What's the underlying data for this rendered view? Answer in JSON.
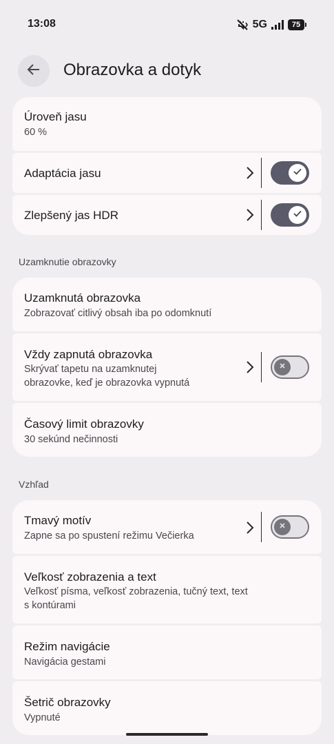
{
  "status_bar": {
    "time": "13:08",
    "network": "5G",
    "battery": "75"
  },
  "header": {
    "title": "Obrazovka a dotyk"
  },
  "brightness_group": {
    "brightness_level": {
      "title": "Úroveň jasu",
      "subtitle": "60 %"
    },
    "adaptive_brightness": {
      "title": "Adaptácia jasu",
      "toggle": "on"
    },
    "hdr_brightness": {
      "title": "Zlepšený jas HDR",
      "toggle": "on"
    }
  },
  "lock_section": {
    "label": "Uzamknutie obrazovky",
    "lock_screen": {
      "title": "Uzamknutá obrazovka",
      "subtitle": "Zobrazovať citlivý obsah iba po odomknutí"
    },
    "always_on": {
      "title": "Vždy zapnutá obrazovka",
      "subtitle_line1": "Skrývať tapetu na uzamknutej",
      "subtitle_line2": "obrazovke, keď je obrazovka vypnutá",
      "toggle": "off"
    },
    "timeout": {
      "title": "Časový limit obrazovky",
      "subtitle": "30 sekúnd nečinnosti"
    }
  },
  "appearance_section": {
    "label": "Vzhľad",
    "dark_theme": {
      "title": "Tmavý motív",
      "subtitle": "Zapne sa po spustení režimu Večierka",
      "toggle": "off"
    },
    "display_size": {
      "title": "Veľkosť zobrazenia a text",
      "subtitle_line1": "Veľkosť písma, veľkosť zobrazenia, tučný text, text",
      "subtitle_line2": "s kontúrami"
    },
    "navigation_mode": {
      "title": "Režim navigácie",
      "subtitle": "Navigácia gestami"
    },
    "screen_saver": {
      "title": "Šetrič obrazovky",
      "subtitle": "Vypnuté"
    }
  },
  "icons": {
    "back": "arrow-left-icon",
    "chevron": "chevron-right-icon",
    "check": "check-icon",
    "close": "close-icon",
    "mute": "vibrate-off-icon",
    "signal": "signal-icon"
  },
  "colors": {
    "background": "#efedef",
    "card": "#fcf8fa",
    "toggle_on": "#5a5a6a",
    "toggle_off_knob": "#77757c"
  }
}
